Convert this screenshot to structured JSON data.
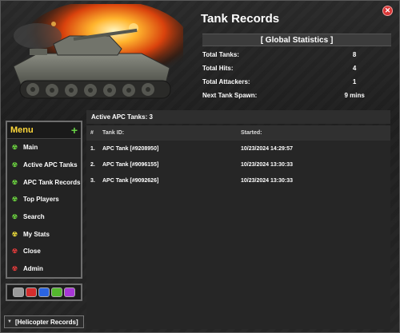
{
  "window": {
    "title": "Tank Records"
  },
  "global": {
    "header": "[ Global Statistics ]",
    "stats": [
      {
        "label": "Total Tanks:",
        "value": "8"
      },
      {
        "label": "Total Hits:",
        "value": "4"
      },
      {
        "label": "Total Attackers:",
        "value": "1"
      },
      {
        "label": "Next Tank Spawn:",
        "value": "9 mins"
      }
    ]
  },
  "sidebar": {
    "title": "Menu",
    "items": [
      {
        "label": "Main",
        "icon": "radiation-icon",
        "color": "#6bd33f"
      },
      {
        "label": "Active APC Tanks",
        "icon": "radiation-icon",
        "color": "#6bd33f"
      },
      {
        "label": "APC Tank Records",
        "icon": "radiation-icon",
        "color": "#6bd33f"
      },
      {
        "label": "Top Players",
        "icon": "radiation-icon",
        "color": "#6bd33f"
      },
      {
        "label": "Search",
        "icon": "radiation-icon",
        "color": "#6bd33f"
      },
      {
        "label": "My Stats",
        "icon": "radiation-icon",
        "color": "#e8d83a"
      },
      {
        "label": "Close",
        "icon": "radiation-icon",
        "color": "#e23b3b"
      },
      {
        "label": "Admin",
        "icon": "radiation-icon",
        "color": "#e23b3b"
      }
    ]
  },
  "palette": [
    "#9a9a9a",
    "#d42d2d",
    "#2a64e0",
    "#54b82e",
    "#a737d6"
  ],
  "helicopter_button": "[Helicopter Records]",
  "main": {
    "active_label": "Active APC Tanks: 3",
    "columns": {
      "num": "#",
      "id": "Tank ID:",
      "started": "Started:"
    },
    "rows": [
      {
        "num": "1.",
        "id": "APC Tank [#9208950]",
        "started": "10/23/2024 14:29:57"
      },
      {
        "num": "2.",
        "id": "APC Tank [#9096155]",
        "started": "10/23/2024 13:30:33"
      },
      {
        "num": "3.",
        "id": "APC Tank [#9092626]",
        "started": "10/23/2024 13:30:33"
      }
    ]
  }
}
